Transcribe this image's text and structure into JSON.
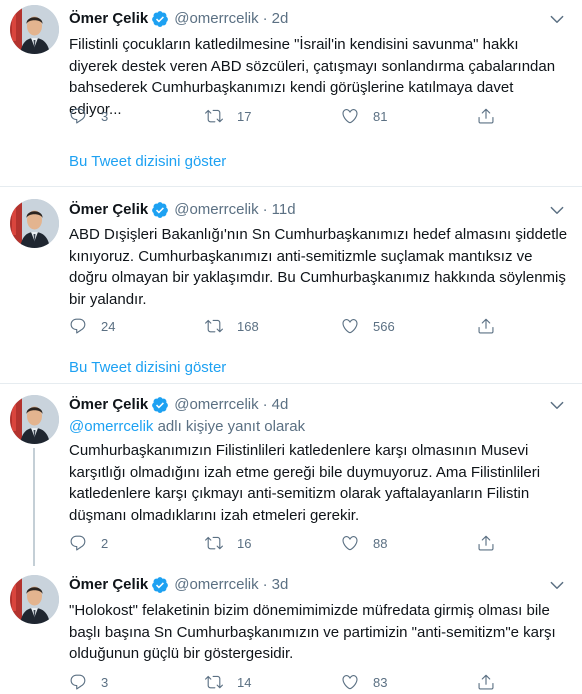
{
  "colors": {
    "accent": "#1da1f2",
    "secondary_text": "#5b7083",
    "primary_text": "#0f1419",
    "divider": "#e6ecf0"
  },
  "tweets": [
    {
      "name": "Ömer Çelik",
      "handle": "@omerrcelik",
      "separator": "·",
      "time": "2d",
      "text": "Filistinli çocukların katledilmesine \"İsrail'in kendisini savunma\" hakkı diyerek destek veren ABD sözcüleri, çatışmayı sonlandırma çabalarından bahsederek Cumhurbaşkanımızı kendi görüşlerine katılmaya davet ediyor...",
      "replies": "3",
      "retweets": "17",
      "likes": "81",
      "thread_link": "Bu Tweet dizisini göster"
    },
    {
      "name": "Ömer Çelik",
      "handle": "@omerrcelik",
      "separator": "·",
      "time": "11d",
      "text": "ABD Dışişleri Bakanlığı'nın Sn Cumhurbaşkanımızı hedef almasını şiddetle kınıyoruz. Cumhurbaşkanımızı anti-semitizmle suçlamak mantıksız ve doğru olmayan bir yaklaşımdır. Bu Cumhurbaşkanımız hakkında söylenmiş bir yalandır.",
      "replies": "24",
      "retweets": "168",
      "likes": "566",
      "thread_link": "Bu Tweet dizisini göster"
    },
    {
      "name": "Ömer Çelik",
      "handle": "@omerrcelik",
      "separator": "·",
      "time": "4d",
      "reply_to_handle": "@omerrcelik",
      "reply_to_suffix": " adlı kişiye yanıt olarak",
      "text": "Cumhurbaşkanımızın Filistinlileri katledenlere karşı olmasının Musevi karşıtlığı olmadığını izah etme gereği bile duymuyoruz. Ama Filistinlileri katledenlere karşı çıkmayı anti-semitizm olarak yaftalayanların Filistin düşmanı olmadıklarını izah etmeleri gerekir.",
      "replies": "2",
      "retweets": "16",
      "likes": "88"
    },
    {
      "name": "Ömer Çelik",
      "handle": "@omerrcelik",
      "separator": "·",
      "time": "3d",
      "text": "\"Holokost\" felaketinin bizim dönemimimizde müfredata girmiş olması bile başlı başına Sn Cumhurbaşkanımızın ve partimizin \"anti-semitizm\"e karşı olduğunun güçlü bir göstergesidir.",
      "replies": "3",
      "retweets": "14",
      "likes": "83"
    }
  ]
}
